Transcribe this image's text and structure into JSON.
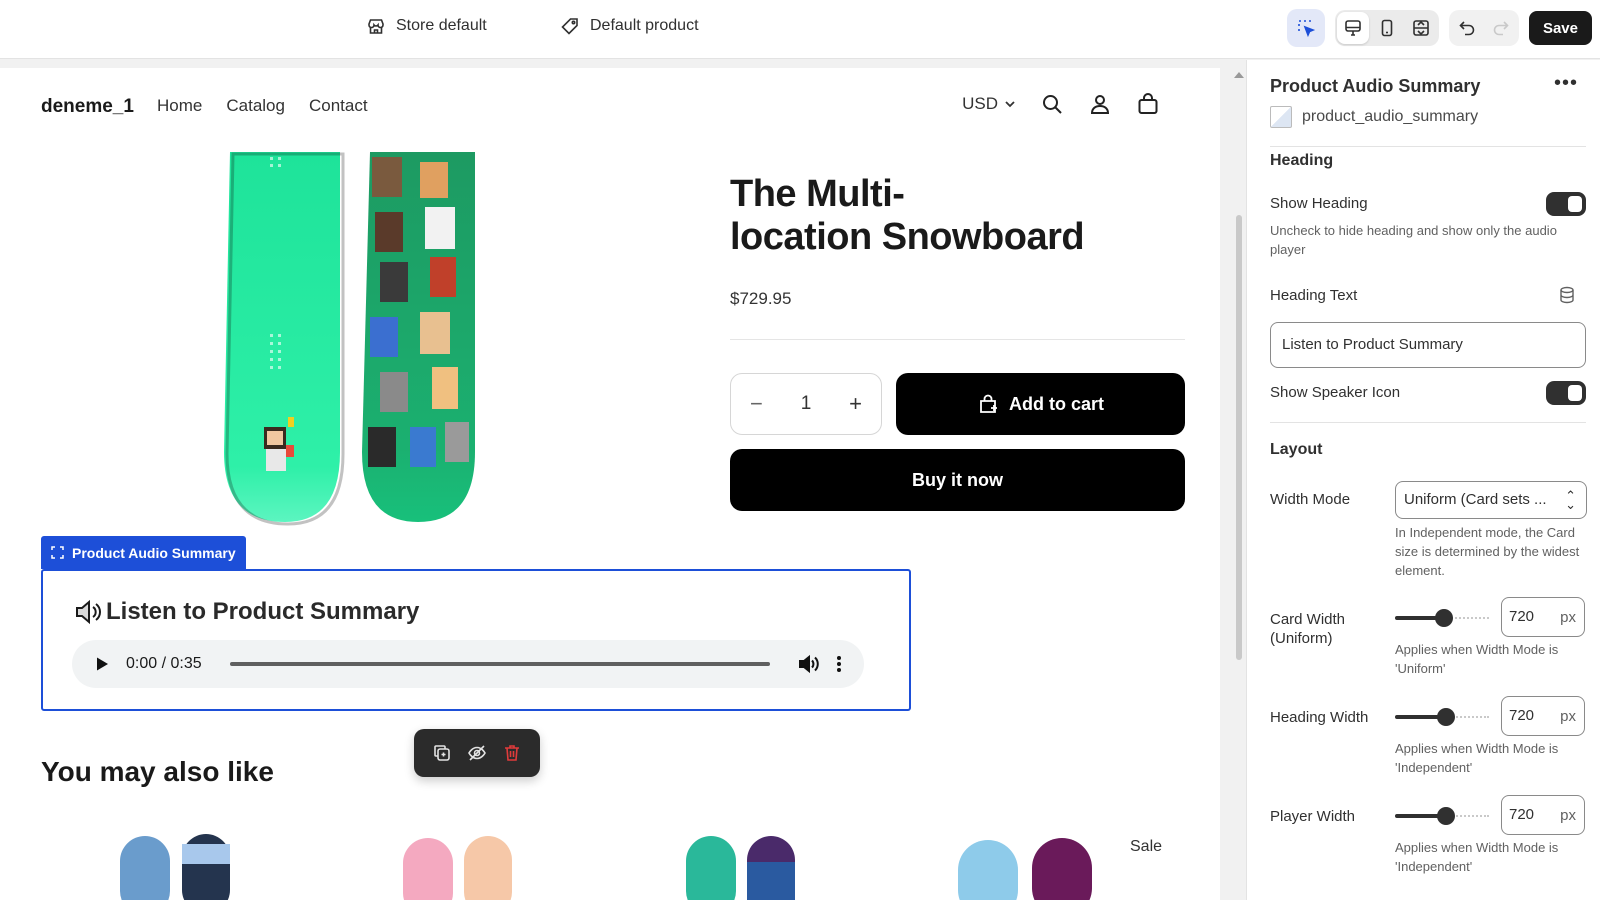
{
  "topbar": {
    "store": "Store default",
    "product": "Default product",
    "save_label": "Save"
  },
  "store": {
    "brand": "deneme_1",
    "nav": [
      "Home",
      "Catalog",
      "Contact"
    ],
    "currency": "USD"
  },
  "product": {
    "title_line1": "The Multi-",
    "title_line2": "location Snowboard",
    "price": "$729.95",
    "quantity": "1",
    "add_to_cart": "Add to cart",
    "buy_now": "Buy it now"
  },
  "audio_block": {
    "tag": "Product Audio Summary",
    "heading": "Listen to Product Summary",
    "time": "0:00 / 0:35"
  },
  "recommendations": {
    "heading": "You may also like",
    "sale_badge": "Sale"
  },
  "panel": {
    "title": "Product Audio Summary",
    "block_id": "product_audio_summary",
    "heading_section": "Heading",
    "show_heading_label": "Show Heading",
    "show_heading_help": "Uncheck to hide heading and show only the audio player",
    "heading_text_label": "Heading Text",
    "heading_text_value": "Listen to Product Summary",
    "show_speaker_label": "Show Speaker Icon",
    "layout_section": "Layout",
    "width_mode_label": "Width Mode",
    "width_mode_value": "Uniform (Card sets ...",
    "width_mode_help": "In Independent mode, the Card size is determined by the widest element.",
    "card_width_label1": "Card Width",
    "card_width_label2": "(Uniform)",
    "card_width_value": "720",
    "card_width_help": "Applies when Width Mode is 'Uniform'",
    "heading_width_label": "Heading Width",
    "heading_width_value": "720",
    "heading_width_help": "Applies when Width Mode is 'Independent'",
    "player_width_label": "Player Width",
    "player_width_value": "720",
    "player_width_help": "Applies when Width Mode is 'Independent'",
    "unit": "px"
  }
}
